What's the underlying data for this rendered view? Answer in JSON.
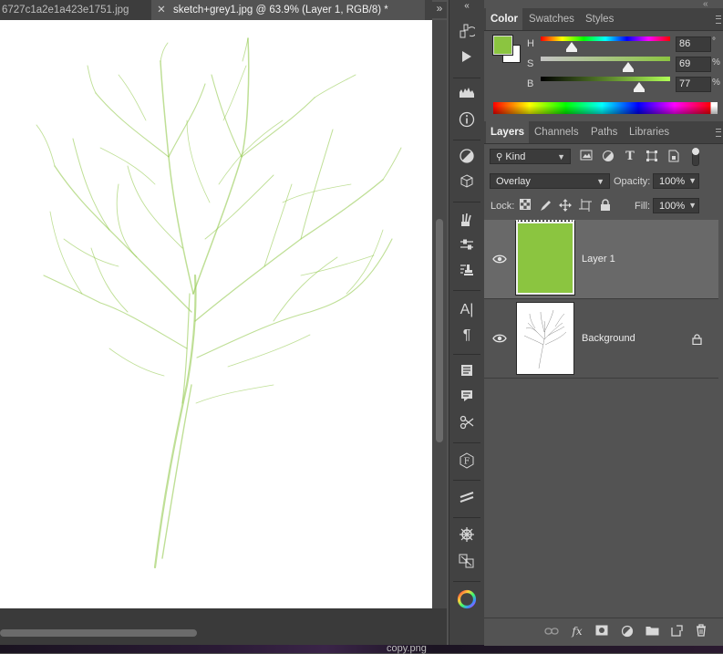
{
  "document": {
    "tabs": [
      {
        "label": "6727c1a2e1a423e1751.jpg",
        "active": false
      },
      {
        "label": "sketch+grey1.jpg @ 63.9% (Layer 1, RGB/8) *",
        "active": true
      }
    ],
    "close_glyph": "✕",
    "overflow_glyph": "»",
    "taskbar_label": "copy.png"
  },
  "tools": {
    "collapse_glyph": "«",
    "icons": [
      "history-brush-icon",
      "play-icon",
      "histogram-icon",
      "info-icon",
      "adjustments-icon",
      "3d-icon",
      "brush-presets-icon",
      "tool-presets-icon",
      "clone-source-icon",
      "character-icon",
      "paragraph-icon",
      "character-styles-icon",
      "paragraph-styles-icon",
      "measurement-icon",
      "font-icon",
      "glyphs-icon",
      "timeline-icon",
      "properties-icon",
      "color-wheel-icon"
    ]
  },
  "color_panel": {
    "collapse_glyph": "«",
    "tabs": [
      "Color",
      "Swatches",
      "Styles"
    ],
    "active_tab": "Color",
    "foreground": "#8bc540",
    "background": "#ffffff",
    "sliders": [
      {
        "label": "H",
        "value": "86",
        "unit": "°",
        "position": 0.24
      },
      {
        "label": "S",
        "value": "69",
        "unit": "%",
        "position": 0.69
      },
      {
        "label": "B",
        "value": "77",
        "unit": "%",
        "position": 0.77
      }
    ]
  },
  "layers_panel": {
    "tabs": [
      "Layers",
      "Channels",
      "Paths",
      "Libraries"
    ],
    "active_tab": "Layers",
    "filter_label": "Kind",
    "blend_mode": "Overlay",
    "opacity_label": "Opacity:",
    "opacity_value": "100%",
    "lock_label": "Lock:",
    "fill_label": "Fill:",
    "fill_value": "100%",
    "layers": [
      {
        "name": "Layer 1",
        "color": "#8bc540",
        "selected": true,
        "locked": false
      },
      {
        "name": "Background",
        "color": "#ffffff",
        "selected": false,
        "locked": true
      }
    ]
  }
}
